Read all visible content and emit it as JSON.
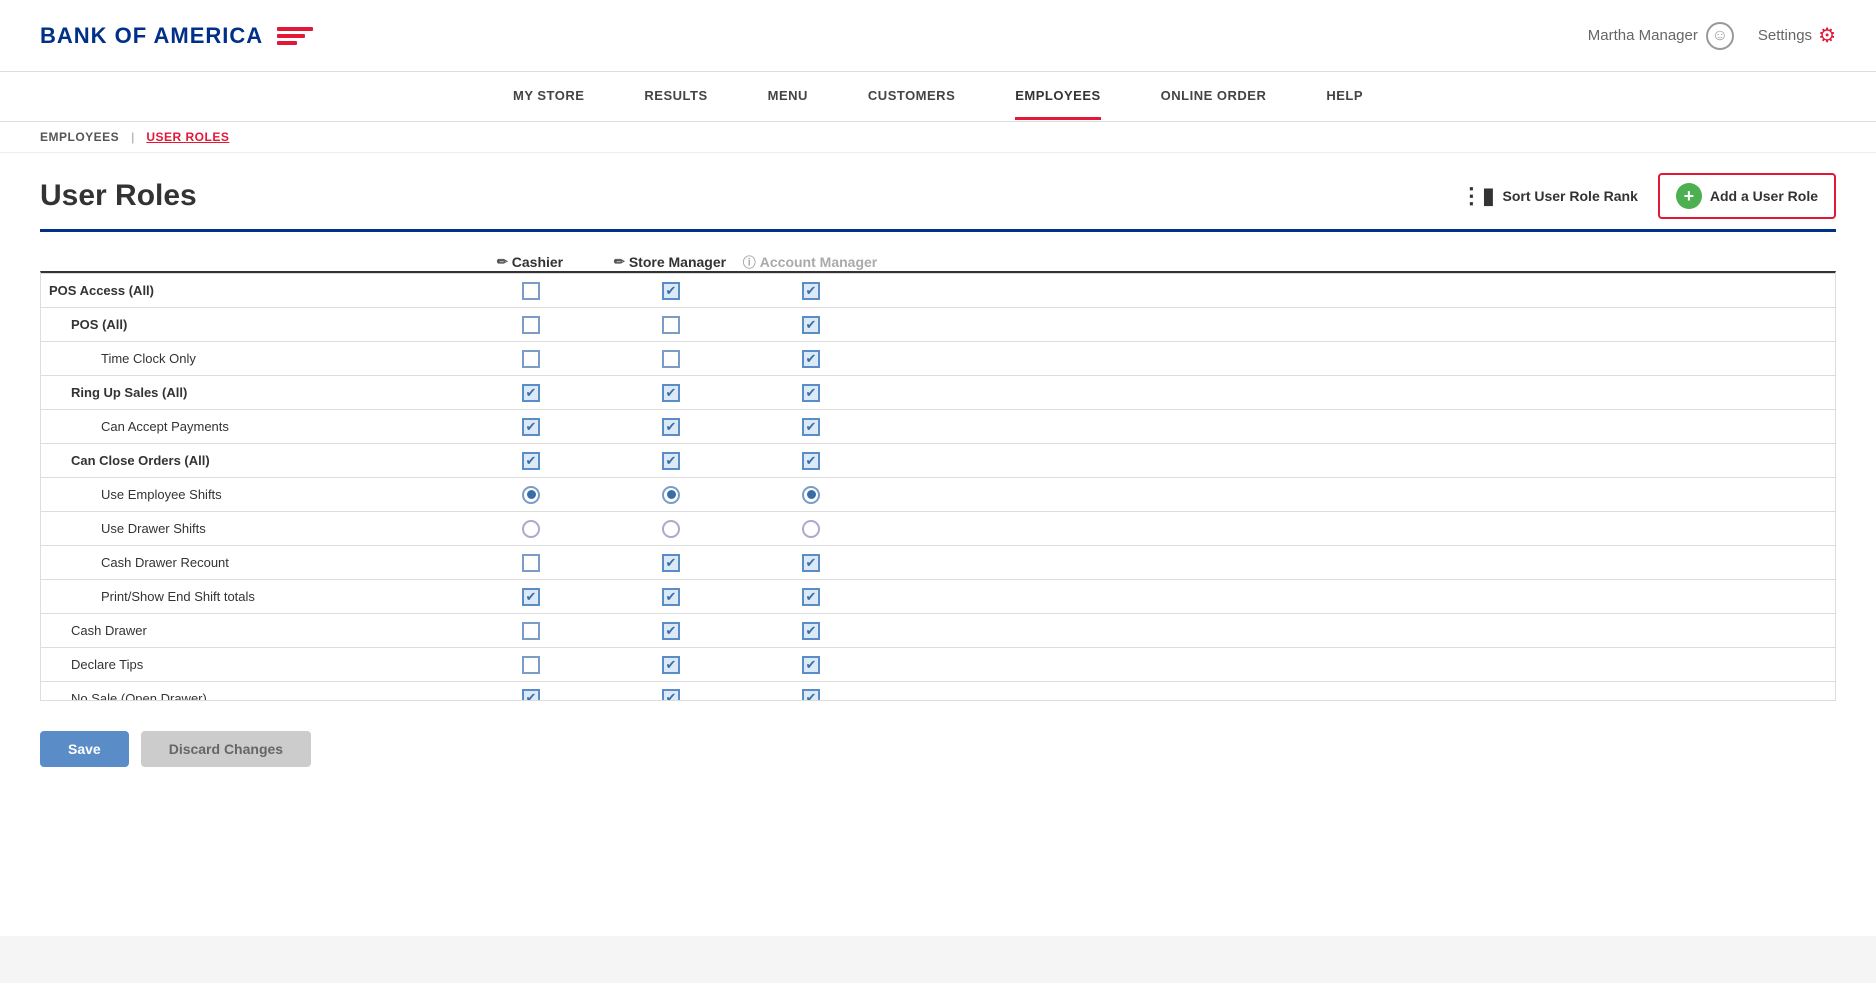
{
  "header": {
    "logo_text": "BANK OF AMERICA",
    "user_name": "Martha Manager",
    "settings_label": "Settings"
  },
  "nav": {
    "items": [
      {
        "label": "MY STORE",
        "active": false
      },
      {
        "label": "RESULTS",
        "active": false
      },
      {
        "label": "MENU",
        "active": false
      },
      {
        "label": "CUSTOMERS",
        "active": false
      },
      {
        "label": "EMPLOYEES",
        "active": true
      },
      {
        "label": "ONLINE ORDER",
        "active": false
      },
      {
        "label": "HELP",
        "active": false
      }
    ]
  },
  "breadcrumb": {
    "parent": "EMPLOYEES",
    "current": "USER ROLES"
  },
  "page": {
    "title": "User Roles",
    "sort_label": "Sort User Role Rank",
    "add_label": "Add a User Role"
  },
  "roles": {
    "columns": [
      {
        "label": "Cashier",
        "editable": true,
        "disabled": false
      },
      {
        "label": "Store Manager",
        "editable": true,
        "disabled": false
      },
      {
        "label": "Account Manager",
        "editable": false,
        "disabled": true
      }
    ],
    "rows": [
      {
        "label": "POS Access (All)",
        "level": 0,
        "bold": true,
        "type": "checkbox",
        "values": [
          false,
          true,
          true
        ]
      },
      {
        "label": "POS (All)",
        "level": 1,
        "bold": true,
        "type": "checkbox",
        "values": [
          false,
          false,
          true
        ]
      },
      {
        "label": "Time Clock Only",
        "level": 2,
        "bold": false,
        "type": "checkbox",
        "values": [
          false,
          false,
          true
        ]
      },
      {
        "label": "Ring Up Sales (All)",
        "level": 1,
        "bold": true,
        "type": "checkbox",
        "values": [
          true,
          true,
          true
        ]
      },
      {
        "label": "Can Accept Payments",
        "level": 2,
        "bold": false,
        "type": "checkbox",
        "values": [
          true,
          true,
          true
        ]
      },
      {
        "label": "Can Close Orders (All)",
        "level": 1,
        "bold": true,
        "type": "checkbox",
        "values": [
          true,
          true,
          true
        ]
      },
      {
        "label": "Use Employee Shifts",
        "level": 2,
        "bold": false,
        "type": "radio",
        "values": [
          true,
          true,
          true
        ]
      },
      {
        "label": "Use Drawer Shifts",
        "level": 2,
        "bold": false,
        "type": "radio",
        "values": [
          false,
          false,
          false
        ]
      },
      {
        "label": "Cash Drawer Recount",
        "level": 2,
        "bold": false,
        "type": "checkbox",
        "values": [
          false,
          true,
          true
        ]
      },
      {
        "label": "Print/Show End Shift totals",
        "level": 2,
        "bold": false,
        "type": "checkbox",
        "values": [
          true,
          true,
          true
        ]
      },
      {
        "label": "Cash Drawer",
        "level": 1,
        "bold": false,
        "type": "checkbox",
        "values": [
          false,
          true,
          true
        ]
      },
      {
        "label": "Declare Tips",
        "level": 1,
        "bold": false,
        "type": "checkbox",
        "values": [
          false,
          true,
          true
        ]
      },
      {
        "label": "No Sale (Open Drawer)",
        "level": 1,
        "bold": false,
        "type": "checkbox",
        "values": [
          true,
          true,
          true
        ]
      }
    ]
  },
  "buttons": {
    "save": "Save",
    "discard": "Discard Changes"
  }
}
